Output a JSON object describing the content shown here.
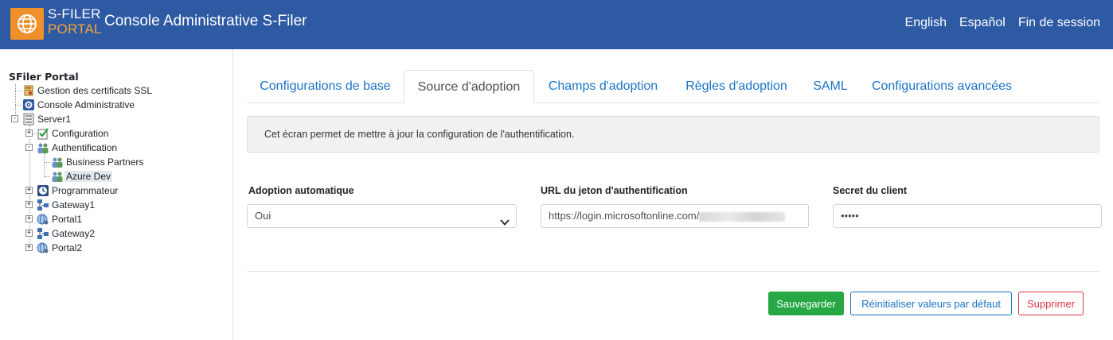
{
  "header": {
    "logo_line1": "S-FILER",
    "logo_line2": "PORTAL",
    "title": "Console Administrative S-Filer",
    "nav": [
      "English",
      "Español",
      "Fin de session"
    ]
  },
  "sidebar": {
    "root": "SFiler Portal",
    "nodes": [
      {
        "label": "Gestion des certificats SSL",
        "icon": "certificate-icon"
      },
      {
        "label": "Console Administrative",
        "icon": "gear-icon"
      },
      {
        "label": "Server1",
        "icon": "server-icon",
        "expander": "-"
      },
      {
        "label": "Configuration",
        "icon": "checklist-icon",
        "expander": "+"
      },
      {
        "label": "Authentification",
        "icon": "users-icon",
        "expander": "-"
      },
      {
        "label": "Business Partners",
        "icon": "users-icon"
      },
      {
        "label": "Azure Dev",
        "icon": "users-icon",
        "selected": true
      },
      {
        "label": "Programmateur",
        "icon": "clock-icon",
        "expander": "+"
      },
      {
        "label": "Gateway1",
        "icon": "network-icon",
        "expander": "+"
      },
      {
        "label": "Portal1",
        "icon": "globe-icon",
        "expander": "+"
      },
      {
        "label": "Gateway2",
        "icon": "network-icon",
        "expander": "+"
      },
      {
        "label": "Portal2",
        "icon": "globe-icon",
        "expander": "+"
      }
    ]
  },
  "tabs": [
    {
      "label": "Configurations de base",
      "active": false
    },
    {
      "label": "Source d'adoption",
      "active": true
    },
    {
      "label": "Champs d'adoption",
      "active": false
    },
    {
      "label": "Règles d'adoption",
      "active": false
    },
    {
      "label": "SAML",
      "active": false
    },
    {
      "label": "Configurations avancées",
      "active": false
    }
  ],
  "info_text": "Cet écran permet de mettre à jour la configuration de l'authentification.",
  "form": {
    "auto_adoption": {
      "label": "Adoption automatique",
      "value": "Oui"
    },
    "token_url": {
      "label": "URL du jeton d'authentification",
      "value": "https://login.microsoftonline.com/"
    },
    "client_secret": {
      "label": "Secret du client",
      "value": "•••••"
    }
  },
  "buttons": {
    "save": "Sauvegarder",
    "reset": "Réinitialiser valeurs par défaut",
    "delete": "Supprimer"
  },
  "colors": {
    "header_bg": "#2e5aa4",
    "logo_orange": "#f0902a",
    "link_blue": "#1a73c9",
    "save_green": "#28a745",
    "delete_red": "#dc3545"
  }
}
